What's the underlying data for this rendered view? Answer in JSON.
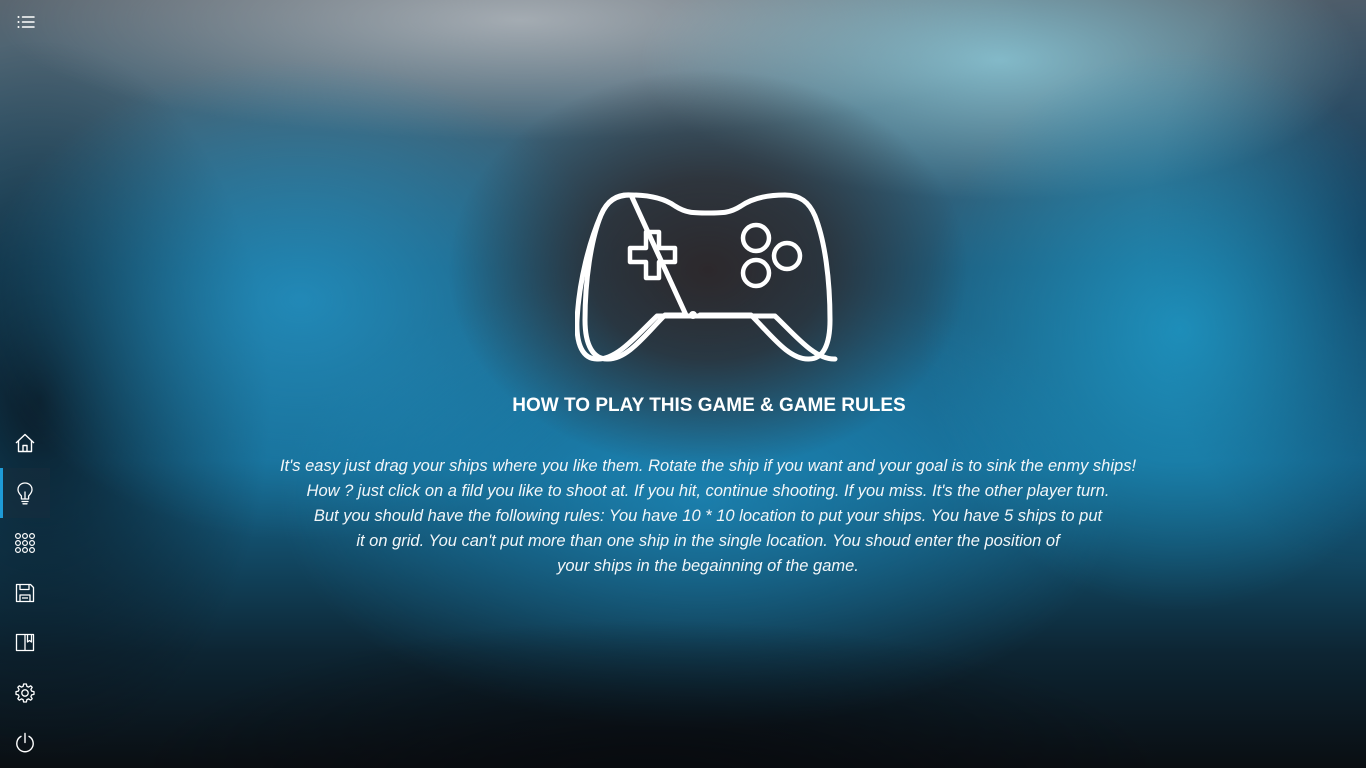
{
  "menu": {
    "icon": "list-menu-icon"
  },
  "sidebar": {
    "items": [
      {
        "name": "home",
        "icon": "home-icon",
        "active": false
      },
      {
        "name": "tips",
        "icon": "lightbulb-icon",
        "active": true
      },
      {
        "name": "apps",
        "icon": "grid-icon",
        "active": false
      },
      {
        "name": "save",
        "icon": "save-icon",
        "active": false
      },
      {
        "name": "book",
        "icon": "book-icon",
        "active": false
      },
      {
        "name": "settings",
        "icon": "gear-icon",
        "active": false
      },
      {
        "name": "power",
        "icon": "power-icon",
        "active": false
      }
    ],
    "accent_color": "#1e9bd7"
  },
  "hero": {
    "icon": "gamepad-icon"
  },
  "title": "HOW TO PLAY THIS GAME & GAME RULES",
  "rules": {
    "lines": [
      "It's easy just drag your ships where you like them. Rotate the ship if you want and your goal is to sink the enmy ships!",
      "How ? just click on a fild you like to shoot at. If you hit, continue shooting. If you miss. It's the other player turn.",
      "But you should have the following rules: You have 10 * 10 location to put your ships. You have 5 ships to put",
      "it on grid. You can't put more than one ship in the single location. You shoud enter the position of",
      "your ships in the begainning of the game."
    ]
  }
}
